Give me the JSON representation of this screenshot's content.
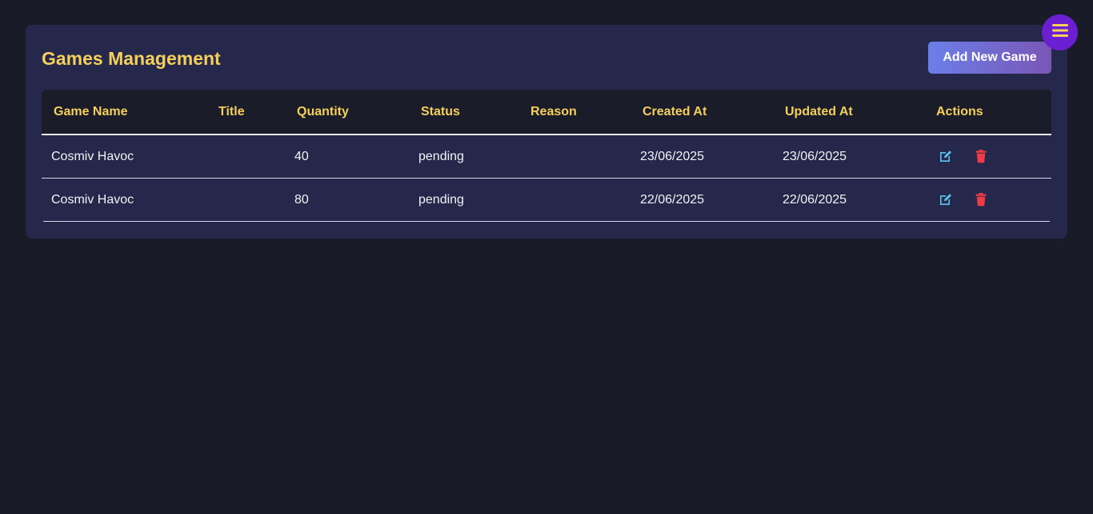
{
  "panel": {
    "title": "Games Management",
    "add_button_label": "Add New Game"
  },
  "table": {
    "columns": [
      "Game Name",
      "Title",
      "Quantity",
      "Status",
      "Reason",
      "Created At",
      "Updated At",
      "Actions"
    ],
    "rows": [
      {
        "game_name": "Cosmiv Havoc",
        "title": "",
        "quantity": "40",
        "status": "pending",
        "reason": "",
        "created_at": "23/06/2025",
        "updated_at": "23/06/2025"
      },
      {
        "game_name": "Cosmiv Havoc",
        "title": "",
        "quantity": "80",
        "status": "pending",
        "reason": "",
        "created_at": "22/06/2025",
        "updated_at": "22/06/2025"
      }
    ]
  },
  "icons": {
    "menu": "hamburger-menu-icon",
    "edit": "edit-icon",
    "delete": "trash-icon"
  },
  "colors": {
    "accent_yellow": "#f5cf5b",
    "edit_blue": "#58c4f0",
    "delete_red": "#ef3b45",
    "menu_purple": "#6a1fd0"
  }
}
